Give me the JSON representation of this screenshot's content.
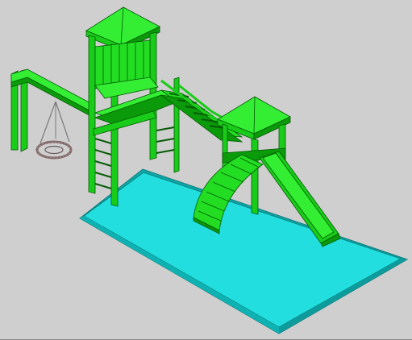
{
  "viewport": {
    "background": "#cfcfcf",
    "colors": {
      "wood_light": "#33ee33",
      "wood_mid": "#19cc19",
      "wood_dark": "#0a9a0a",
      "edge": "#055a05",
      "pool_top": "#22dede",
      "pool_side": "#11a8a8",
      "pool_edge": "#0a7d7d",
      "rope": "#7a7a7a",
      "tire": "#b08080"
    }
  },
  "model": {
    "objects": [
      "swing-frame",
      "tire-swing",
      "tower-left",
      "rope-bridge",
      "tower-right",
      "curved-stair",
      "slide",
      "sand-pit"
    ]
  }
}
